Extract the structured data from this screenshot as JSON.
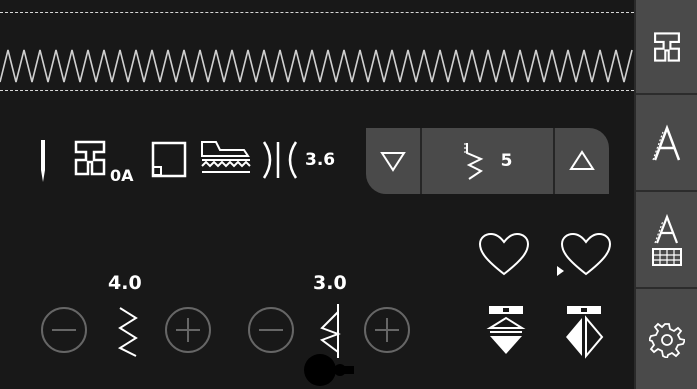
{
  "toolbar": {
    "presser_foot_label": "0A",
    "stitch_plate_value": "3.6"
  },
  "stitch_select": {
    "value": "5"
  },
  "controls": {
    "stitch_width": "4.0",
    "stitch_length": "3.0"
  },
  "sidebar": {
    "items": [
      {
        "icon": "presser-foot-icon"
      },
      {
        "icon": "text-icon"
      },
      {
        "icon": "keyboard-text-icon"
      },
      {
        "icon": "gear-icon"
      }
    ]
  },
  "colors": {
    "background": "#181818",
    "sidebar": "#4a4a4a",
    "foreground": "#ffffff",
    "muted": "#6a6a6a"
  }
}
